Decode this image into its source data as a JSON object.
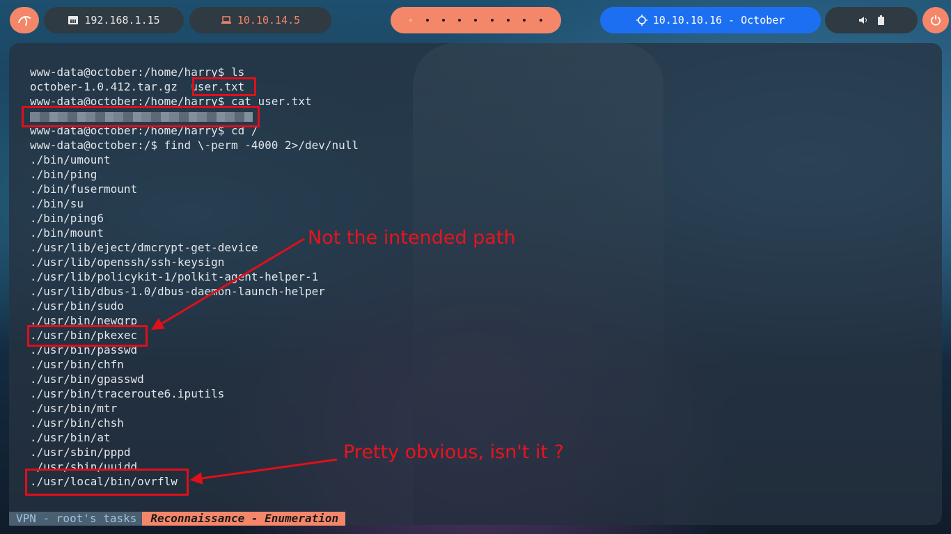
{
  "topbar": {
    "ip_local": "192.168.1.15",
    "ip_vpn": "10.10.14.5",
    "target": "10.10.10.16 - October",
    "workspace_count": 9
  },
  "terminal": {
    "lines": [
      "www-data@october:/home/harry$ ls",
      "october-1.0.412.tar.gz  user.txt",
      "www-data@october:/home/harry$ cat user.txt",
      "",
      "www-data@october:/home/harry$ cd /",
      "www-data@october:/$ find \\-perm -4000 2>/dev/null",
      "./bin/umount",
      "./bin/ping",
      "./bin/fusermount",
      "./bin/su",
      "./bin/ping6",
      "./bin/mount",
      "./usr/lib/eject/dmcrypt-get-device",
      "./usr/lib/openssh/ssh-keysign",
      "./usr/lib/policykit-1/polkit-agent-helper-1",
      "./usr/lib/dbus-1.0/dbus-daemon-launch-helper",
      "./usr/bin/sudo",
      "./usr/bin/newgrp",
      "./usr/bin/pkexec",
      "./usr/bin/passwd",
      "./usr/bin/chfn",
      "./usr/bin/gpasswd",
      "./usr/bin/traceroute6.iputils",
      "./usr/bin/mtr",
      "./usr/bin/chsh",
      "./usr/bin/at",
      "./usr/sbin/pppd",
      "./usr/sbin/uuidd",
      "./usr/local/bin/ovrflw"
    ]
  },
  "annotations": {
    "pkexec_note": "Not the intended path",
    "ovrflw_note": "Pretty obvious, isn't it ?"
  },
  "statusbar": {
    "session": "VPN - root's tasks",
    "window": "Reconnaissance - Enumeration"
  },
  "colors": {
    "accent": "#f4876a",
    "target_blue": "#1d6ff2",
    "annotation_red": "#e00f1a"
  }
}
